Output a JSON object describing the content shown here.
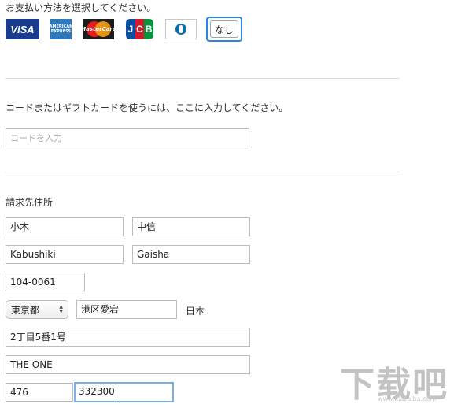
{
  "payment": {
    "heading": "お支払い方法を選択してください。",
    "cards": [
      {
        "name": "VISA",
        "text": "VISA"
      },
      {
        "name": "American Express",
        "text": "AMERICAN EXPRESS"
      },
      {
        "name": "MasterCard",
        "text": "MasterCard"
      },
      {
        "name": "JCB",
        "letters": [
          "J",
          "C",
          "B"
        ]
      },
      {
        "name": "Diners Club"
      }
    ],
    "none_label": "なし"
  },
  "code": {
    "instruction": "コードまたはギフトカードを使うには、ここに入力してください。",
    "placeholder": "コードを入力"
  },
  "billing": {
    "heading": "請求先住所",
    "last_name_kanji": "小木",
    "first_name_kanji": "中信",
    "last_name_roman": "Kabushiki",
    "first_name_roman": "Gaisha",
    "postal_code": "104-0061",
    "prefecture": "東京都",
    "city": "港区愛宕",
    "country": "日本",
    "address_line1": "2丁目5番1号",
    "address_line2": "THE ONE",
    "phone_area": "476",
    "phone_number": "332300"
  },
  "watermark": {
    "text": "下载吧",
    "url": "www.xiazaiba.com"
  },
  "colors": {
    "focus_blue": "#2a86e6",
    "focus_field": "#7bb0e8",
    "divider": "#dcdcdc"
  }
}
